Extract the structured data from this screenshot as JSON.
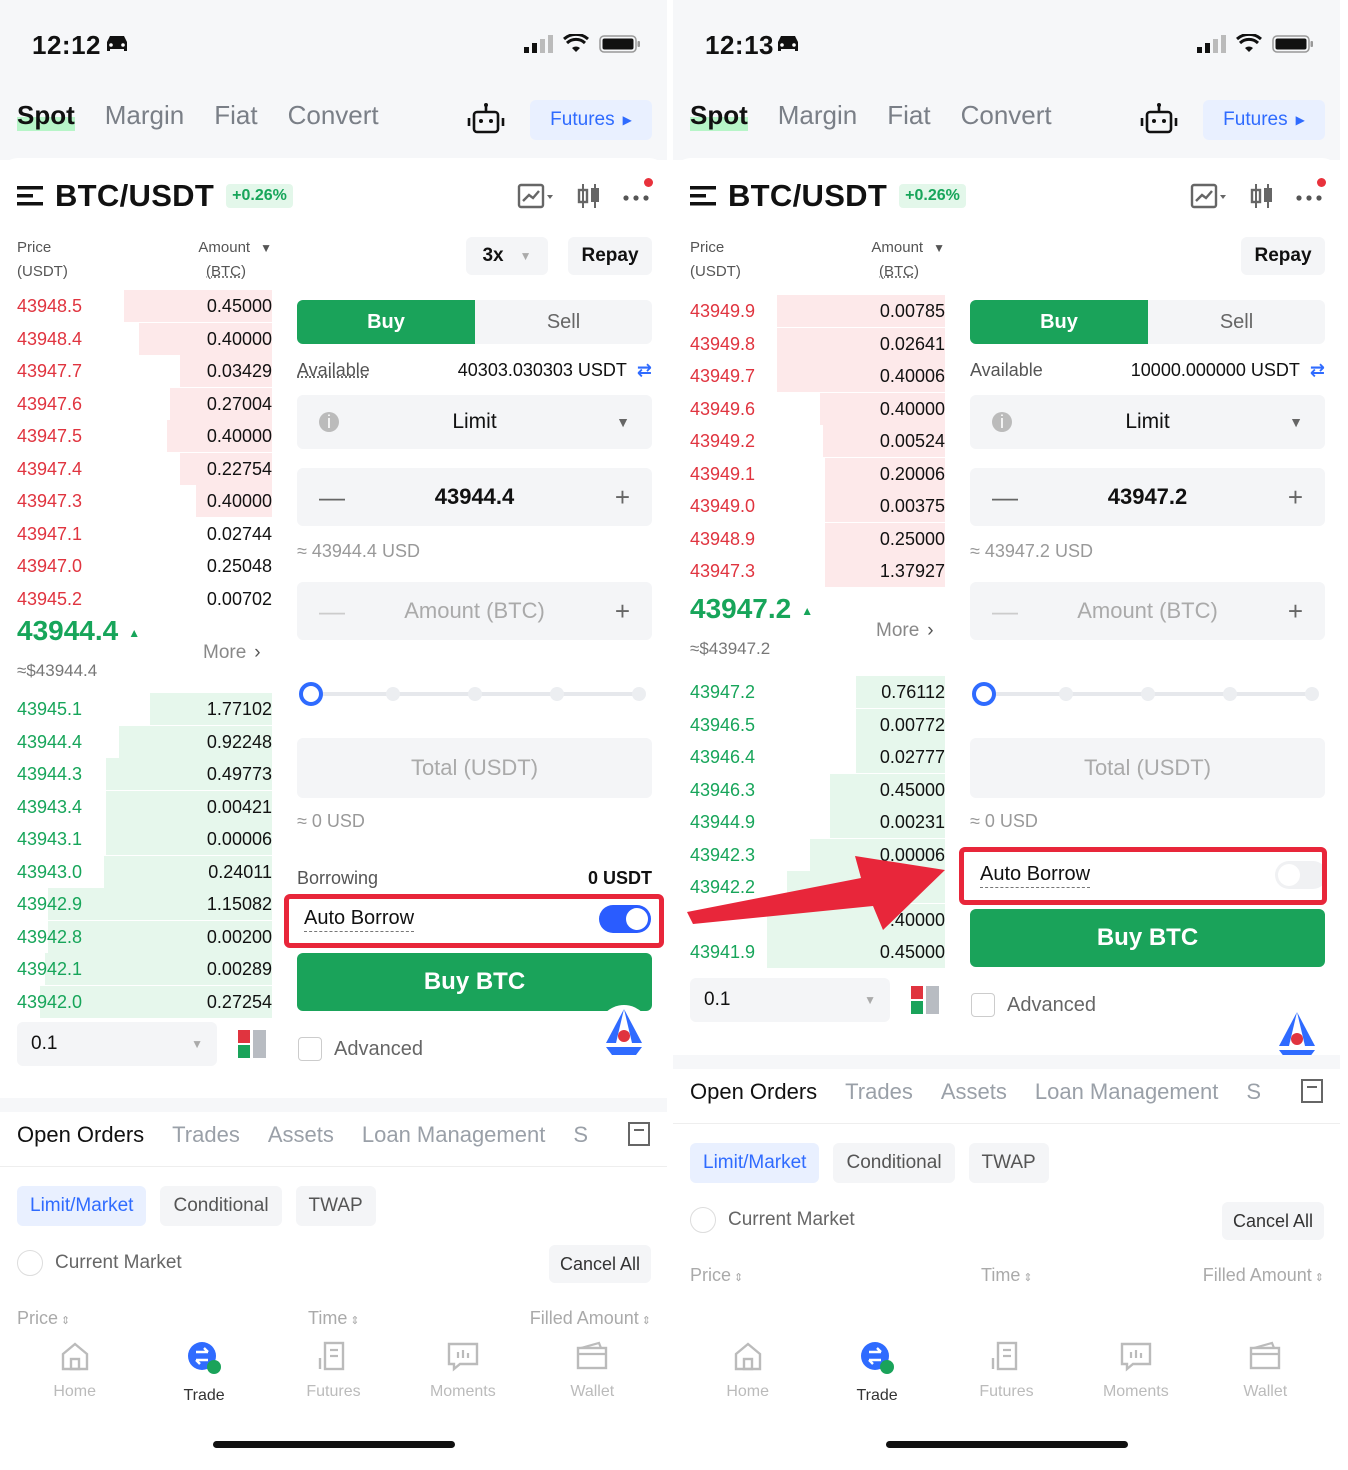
{
  "screens": [
    {
      "time": "12:12",
      "tabs": [
        "Spot",
        "Margin",
        "Fiat",
        "Convert"
      ],
      "futures_label": "Futures",
      "pair": "BTC/USDT",
      "change": "+0.26%",
      "price_header": "Price",
      "price_unit": "(USDT)",
      "amount_header": "Amount",
      "amount_unit": "(BTC)",
      "leverage": "3x",
      "repay_label": "Repay",
      "asks": [
        {
          "p": "43948.5",
          "a": "0.45000",
          "d": 0.58
        },
        {
          "p": "43948.4",
          "a": "0.40000",
          "d": 0.52
        },
        {
          "p": "43947.7",
          "a": "0.03429",
          "d": 0.36
        },
        {
          "p": "43947.6",
          "a": "0.27004",
          "d": 0.4
        },
        {
          "p": "43947.5",
          "a": "0.40000",
          "d": 0.41
        },
        {
          "p": "43947.4",
          "a": "0.22754",
          "d": 0.36
        },
        {
          "p": "43947.3",
          "a": "0.40000",
          "d": 0.3
        },
        {
          "p": "43947.1",
          "a": "0.02744",
          "d": 0.0
        },
        {
          "p": "43947.0",
          "a": "0.25048",
          "d": 0.0
        },
        {
          "p": "43945.2",
          "a": "0.00702",
          "d": 0.0
        }
      ],
      "last_price": "43944.4",
      "last_usd": "≈$43944.4",
      "more_label": "More",
      "bids": [
        {
          "p": "43945.1",
          "a": "1.77102",
          "d": 0.48
        },
        {
          "p": "43944.4",
          "a": "0.92248",
          "d": 0.6
        },
        {
          "p": "43944.3",
          "a": "0.49773",
          "d": 0.65
        },
        {
          "p": "43943.4",
          "a": "0.00421",
          "d": 0.65
        },
        {
          "p": "43943.1",
          "a": "0.00006",
          "d": 0.65
        },
        {
          "p": "43943.0",
          "a": "0.24011",
          "d": 0.66
        },
        {
          "p": "43942.9",
          "a": "1.15082",
          "d": 0.88
        },
        {
          "p": "43942.8",
          "a": "0.00200",
          "d": 0.88
        },
        {
          "p": "43942.1",
          "a": "0.00289",
          "d": 0.89
        },
        {
          "p": "43942.0",
          "a": "0.27254",
          "d": 0.91
        }
      ],
      "buy_label": "Buy",
      "sell_label": "Sell",
      "available_label": "Available",
      "available_value": "40303.030303 USDT",
      "order_type": "Limit",
      "price_value": "43944.4",
      "price_usd": "≈ 43944.4 USD",
      "amount_placeholder": "Amount (BTC)",
      "total_placeholder": "Total (USDT)",
      "total_usd": "≈ 0 USD",
      "borrowing_label": "Borrowing",
      "borrowing_value": "0 USDT",
      "auto_borrow_label": "Auto Borrow",
      "auto_borrow_on": true,
      "buy_btn": "Buy BTC",
      "depth_value": "0.1",
      "advanced_label": "Advanced",
      "order_tabs": [
        "Open Orders",
        "Trades",
        "Assets",
        "Loan Management",
        "S"
      ],
      "order_chips": [
        "Limit/Market",
        "Conditional",
        "TWAP"
      ],
      "current_market": "Current Market",
      "cancel_all": "Cancel All",
      "col_price": "Price",
      "col_time": "Time",
      "col_filled": "Filled Amount",
      "nav": [
        "Home",
        "Trade",
        "Futures",
        "Moments",
        "Wallet"
      ]
    },
    {
      "time": "12:13",
      "tabs": [
        "Spot",
        "Margin",
        "Fiat",
        "Convert"
      ],
      "futures_label": "Futures",
      "pair": "BTC/USDT",
      "change": "+0.26%",
      "price_header": "Price",
      "price_unit": "(USDT)",
      "amount_header": "Amount",
      "amount_unit": "(BTC)",
      "repay_label": "Repay",
      "asks": [
        {
          "p": "43949.9",
          "a": "0.00785",
          "d": 0.66
        },
        {
          "p": "43949.8",
          "a": "0.02641",
          "d": 0.66
        },
        {
          "p": "43949.7",
          "a": "0.40006",
          "d": 0.66
        },
        {
          "p": "43949.6",
          "a": "0.40000",
          "d": 0.49
        },
        {
          "p": "43949.2",
          "a": "0.00524",
          "d": 0.48
        },
        {
          "p": "43949.1",
          "a": "0.20006",
          "d": 0.47
        },
        {
          "p": "43949.0",
          "a": "0.00375",
          "d": 0.47
        },
        {
          "p": "43948.9",
          "a": "0.25000",
          "d": 0.47
        },
        {
          "p": "43947.3",
          "a": "1.37927",
          "d": 0.47
        }
      ],
      "last_price": "43947.2",
      "last_usd": "≈$43947.2",
      "more_label": "More",
      "bids": [
        {
          "p": "43947.2",
          "a": "0.76112",
          "d": 0.35
        },
        {
          "p": "43946.5",
          "a": "0.00772",
          "d": 0.35
        },
        {
          "p": "43946.4",
          "a": "0.02777",
          "d": 0.35
        },
        {
          "p": "43946.3",
          "a": "0.45000",
          "d": 0.45
        },
        {
          "p": "43944.9",
          "a": "0.00231",
          "d": 0.45
        },
        {
          "p": "43942.3",
          "a": "0.00006",
          "d": 0.53
        },
        {
          "p": "43942.2",
          "a": "",
          "d": 0.62
        },
        {
          "p": "",
          "a": "0.40000",
          "d": 0.7
        },
        {
          "p": "43941.9",
          "a": "0.45000",
          "d": 0.7
        }
      ],
      "buy_label": "Buy",
      "sell_label": "Sell",
      "available_label": "Available",
      "available_value": "10000.000000 USDT",
      "order_type": "Limit",
      "price_value": "43947.2",
      "price_usd": "≈ 43947.2 USD",
      "amount_placeholder": "Amount (BTC)",
      "total_placeholder": "Total (USDT)",
      "total_usd": "≈ 0 USD",
      "auto_borrow_label": "Auto Borrow",
      "auto_borrow_on": false,
      "buy_btn": "Buy BTC",
      "depth_value": "0.1",
      "advanced_label": "Advanced",
      "order_tabs": [
        "Open Orders",
        "Trades",
        "Assets",
        "Loan Management",
        "S"
      ],
      "order_chips": [
        "Limit/Market",
        "Conditional",
        "TWAP"
      ],
      "current_market": "Current Market",
      "cancel_all": "Cancel All",
      "col_price": "Price",
      "col_time": "Time",
      "col_filled": "Filled Amount",
      "nav": [
        "Home",
        "Trade",
        "Futures",
        "Moments",
        "Wallet"
      ]
    }
  ],
  "colors": {
    "green": "#1aa35a",
    "red": "#e0343f",
    "blue": "#2f6bff",
    "highlight": "#e8263a"
  }
}
